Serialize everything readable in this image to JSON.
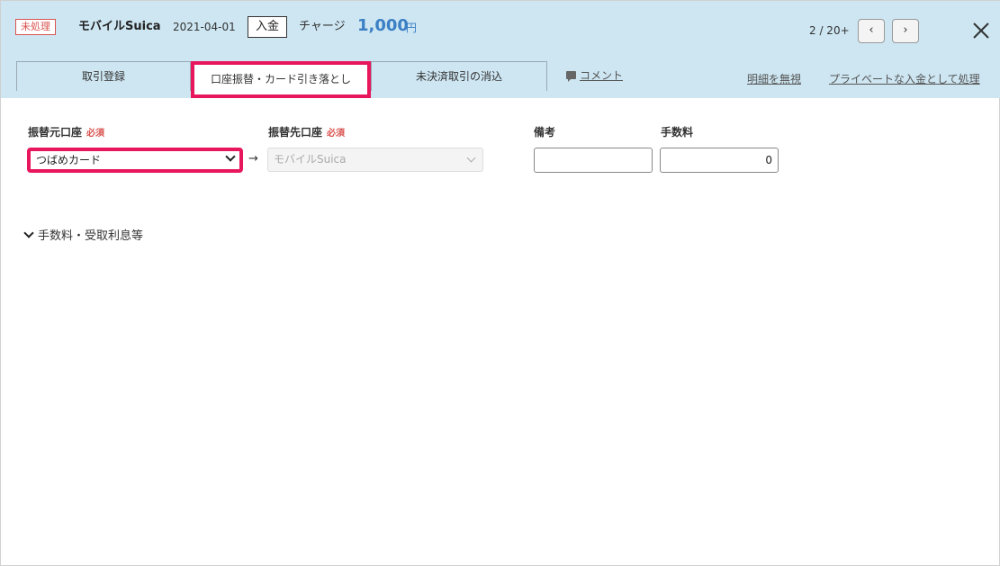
{
  "header": {
    "status": "未処理",
    "account": "モバイルSuica",
    "date": "2021-04-01",
    "type": "入金",
    "description": "チャージ",
    "amount": "1,000",
    "currency": "円",
    "pager": "2 / 20+",
    "prev_label": "‹",
    "next_label": "›",
    "close_icon": "close-icon"
  },
  "tabs": [
    {
      "label": "取引登録"
    },
    {
      "label": "口座振替・カード引き落とし"
    },
    {
      "label": "未決済取引の消込"
    }
  ],
  "links": {
    "comment": "コメント",
    "ignore": "明細を無視",
    "private": "プライベートな入金として処理"
  },
  "form": {
    "from_label": "振替元口座",
    "to_label": "振替先口座",
    "required": "必須",
    "from_value": "つばめカード",
    "to_value": "モバイルSuica",
    "arrow": "→",
    "note_label": "備考",
    "note_value": "",
    "fee_label": "手数料",
    "fee_value": "0"
  },
  "expander": {
    "label": "手数料・受取利息等"
  },
  "colors": {
    "header_bg": "#cde6f2",
    "accent": "#3b7fc4",
    "highlight": "#e8165d",
    "required": "#d9534f"
  }
}
